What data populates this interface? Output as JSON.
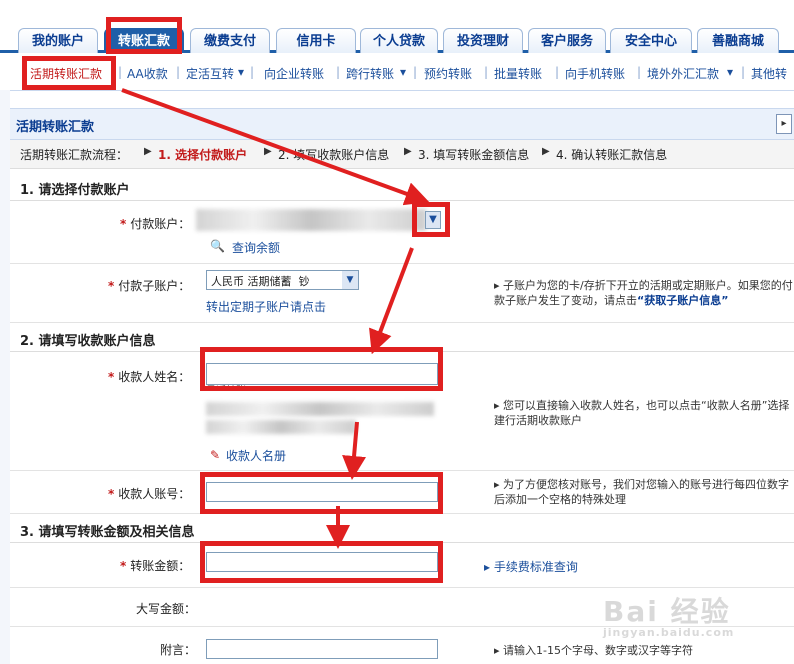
{
  "tabs": [
    "我的账户",
    "转账汇款",
    "缴费支付",
    "信用卡",
    "个人贷款",
    "投资理财",
    "客户服务",
    "安全中心",
    "善融商城"
  ],
  "subnav": [
    "活期转账汇款",
    "AA收款",
    "定活互转",
    "向企业转账",
    "跨行转账",
    "预约转账",
    "批量转账",
    "向手机转账",
    "境外外汇汇款",
    "其他转"
  ],
  "page_title": "活期转账汇款",
  "flow": {
    "label": "活期转账汇款流程：",
    "steps": [
      "1. 选择付款账户",
      "2. 填写收款账户信息",
      "3. 填写转账金额信息",
      "4. 确认转账汇款信息"
    ]
  },
  "section1": {
    "heading": "1. 请选择付款账户",
    "pay_account_label": "付款账户：",
    "query_balance": "查询余额",
    "sub_account_label": "付款子账户：",
    "sub_account_value": "人民币 活期储蓄  钞",
    "sub_account_link": "转出定期子账户请点击",
    "sub_account_hint_pre": "子账户为您的卡/存折下开立的活期或定期账户。如果您的付款子账户发生了变动，请点击",
    "sub_account_hint_link": "“获取子账户信息”"
  },
  "section2": {
    "heading": "2. 请填写收款账户信息",
    "payee_name_label": "收款人姓名：",
    "recent_label": "最近转账",
    "payee_book": "收款人名册",
    "payee_hint": "您可以直接输入收款人姓名，也可以点击“收款人名册”选择建行活期收款账户",
    "payee_account_label": "收款人账号：",
    "account_hint": "为了方便您核对账号，我们对您输入的账号进行每四位数字后添加一个空格的特殊处理"
  },
  "section3": {
    "heading": "3. 请填写转账金额及相关信息",
    "amount_label": "转账金额：",
    "fee_link": "手续费标准查询",
    "capital_label": "大写金额：",
    "memo_label": "附言：",
    "memo_hint": "请输入1-15个字母、数字或汉字等字符"
  },
  "watermark": {
    "main": "Bai 经验",
    "sub": "jingyan.baidu.com"
  },
  "colors": {
    "annotation": "#e02020",
    "brand_blue": "#1f5fa8"
  }
}
